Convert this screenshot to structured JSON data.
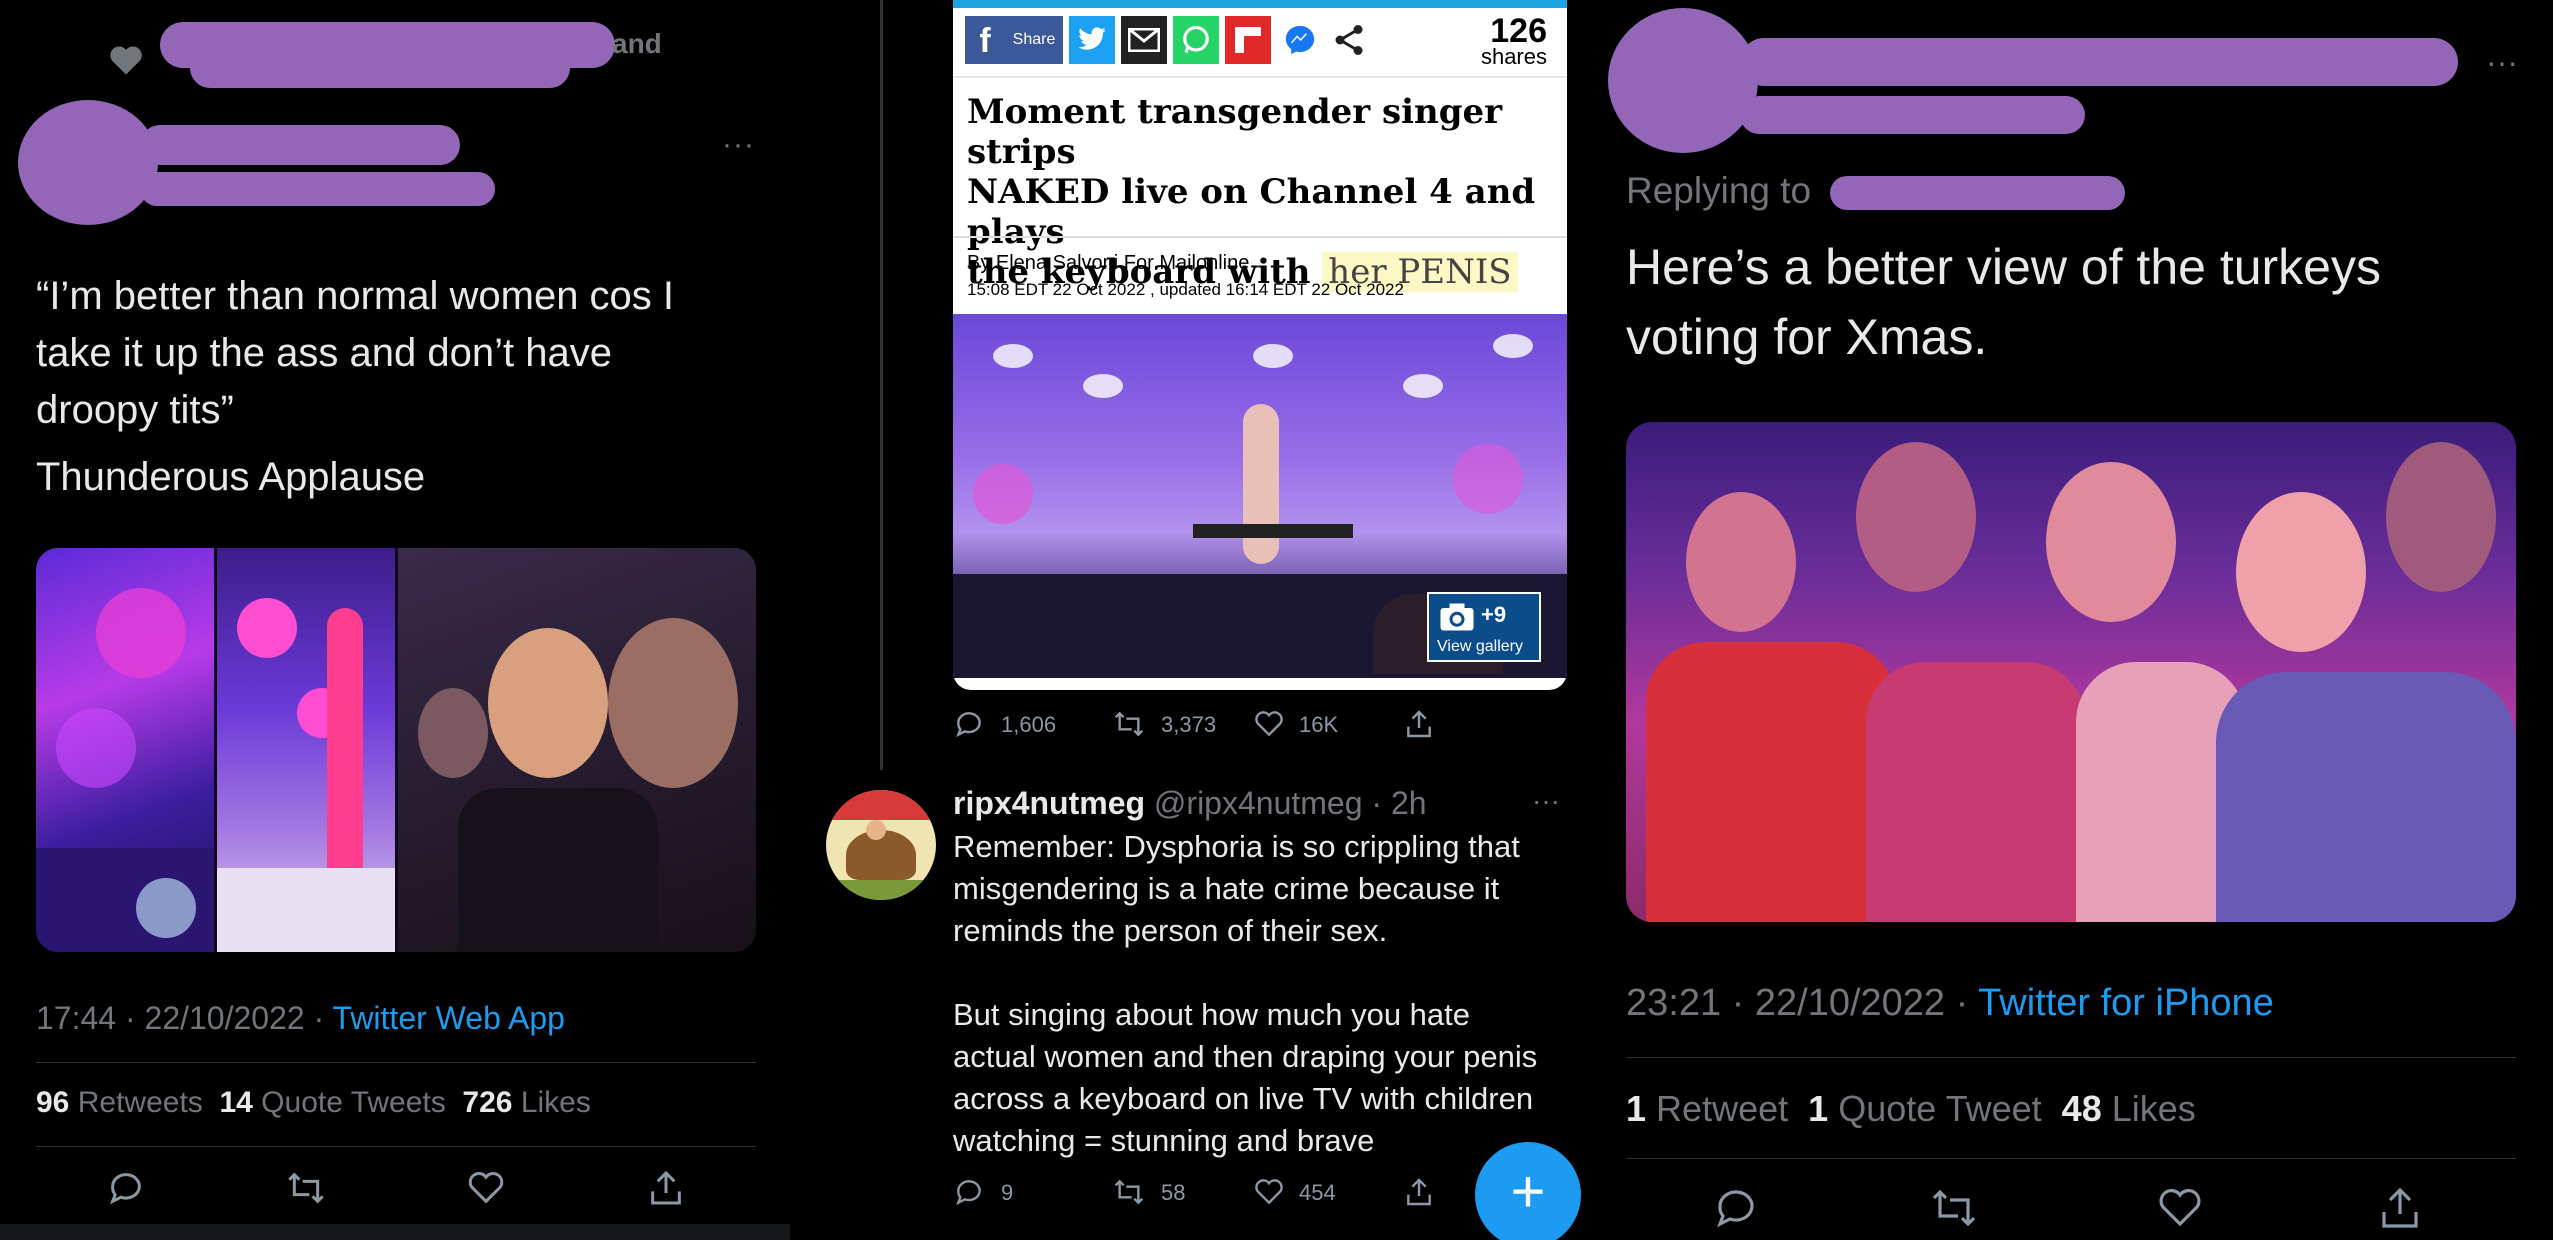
{
  "left": {
    "header_fragment": "and",
    "more": "···",
    "tweet_lines": [
      "“I’m better than normal women cos I",
      "take it up the ass and don’t have",
      "droopy tits”"
    ],
    "tweet_line2": "Thunderous Applause",
    "timestamp": "17:44 · 22/10/2022 · ",
    "source": "Twitter Web App",
    "stats": {
      "retweets_num": "96",
      "retweets_lbl": "Retweets",
      "quotes_num": "14",
      "quotes_lbl": "Quote Tweets",
      "likes_num": "726",
      "likes_lbl": "Likes"
    }
  },
  "middle": {
    "article": {
      "share_label": "Share",
      "shares_count": "126",
      "shares_label": "shares",
      "headline_1": "Moment transgender singer strips",
      "headline_2": "NAKED live on Channel 4 and plays",
      "headline_3a": "the keyboard with ",
      "headline_3b": "her PENIS",
      "byline": "By Elena Salvoni For Mailonline",
      "dateline": "15:08 EDT 22 Oct 2022 , updated 16:14 EDT 22 Oct 2022",
      "gallery_count": "+9",
      "gallery_label": "View gallery"
    },
    "quoted_stats": {
      "replies": "1,606",
      "retweets": "3,373",
      "likes": "16K"
    },
    "reply": {
      "name": "ripx4nutmeg",
      "handle": "@ripx4nutmeg · 2h",
      "more": "···",
      "lines": [
        "Remember: Dysphoria is so crippling that",
        "misgendering is a hate crime because it",
        "reminds the person of their sex.",
        "",
        "But singing about how much you hate",
        "actual women and then draping your penis",
        "across a keyboard on live TV with children",
        "watching = stunning and brave"
      ],
      "stats": {
        "replies": "9",
        "retweets": "58",
        "likes": "454"
      }
    },
    "fab_label": "+"
  },
  "right": {
    "more": "···",
    "replying_to": "Replying to",
    "tweet_lines": [
      "Here’s a better view of the turkeys",
      "voting for Xmas."
    ],
    "timestamp": "23:21 · 22/10/2022 · ",
    "source": "Twitter for iPhone",
    "stats": {
      "retweets_num": "1",
      "retweets_lbl": "Retweet",
      "quotes_num": "1",
      "quotes_lbl": "Quote Tweet",
      "likes_num": "48",
      "likes_lbl": "Likes"
    }
  },
  "colors": {
    "background": "#000000",
    "text": "#e7e9ea",
    "muted": "#71767b",
    "link": "#1d9bf0",
    "redaction": "#9466b8"
  }
}
